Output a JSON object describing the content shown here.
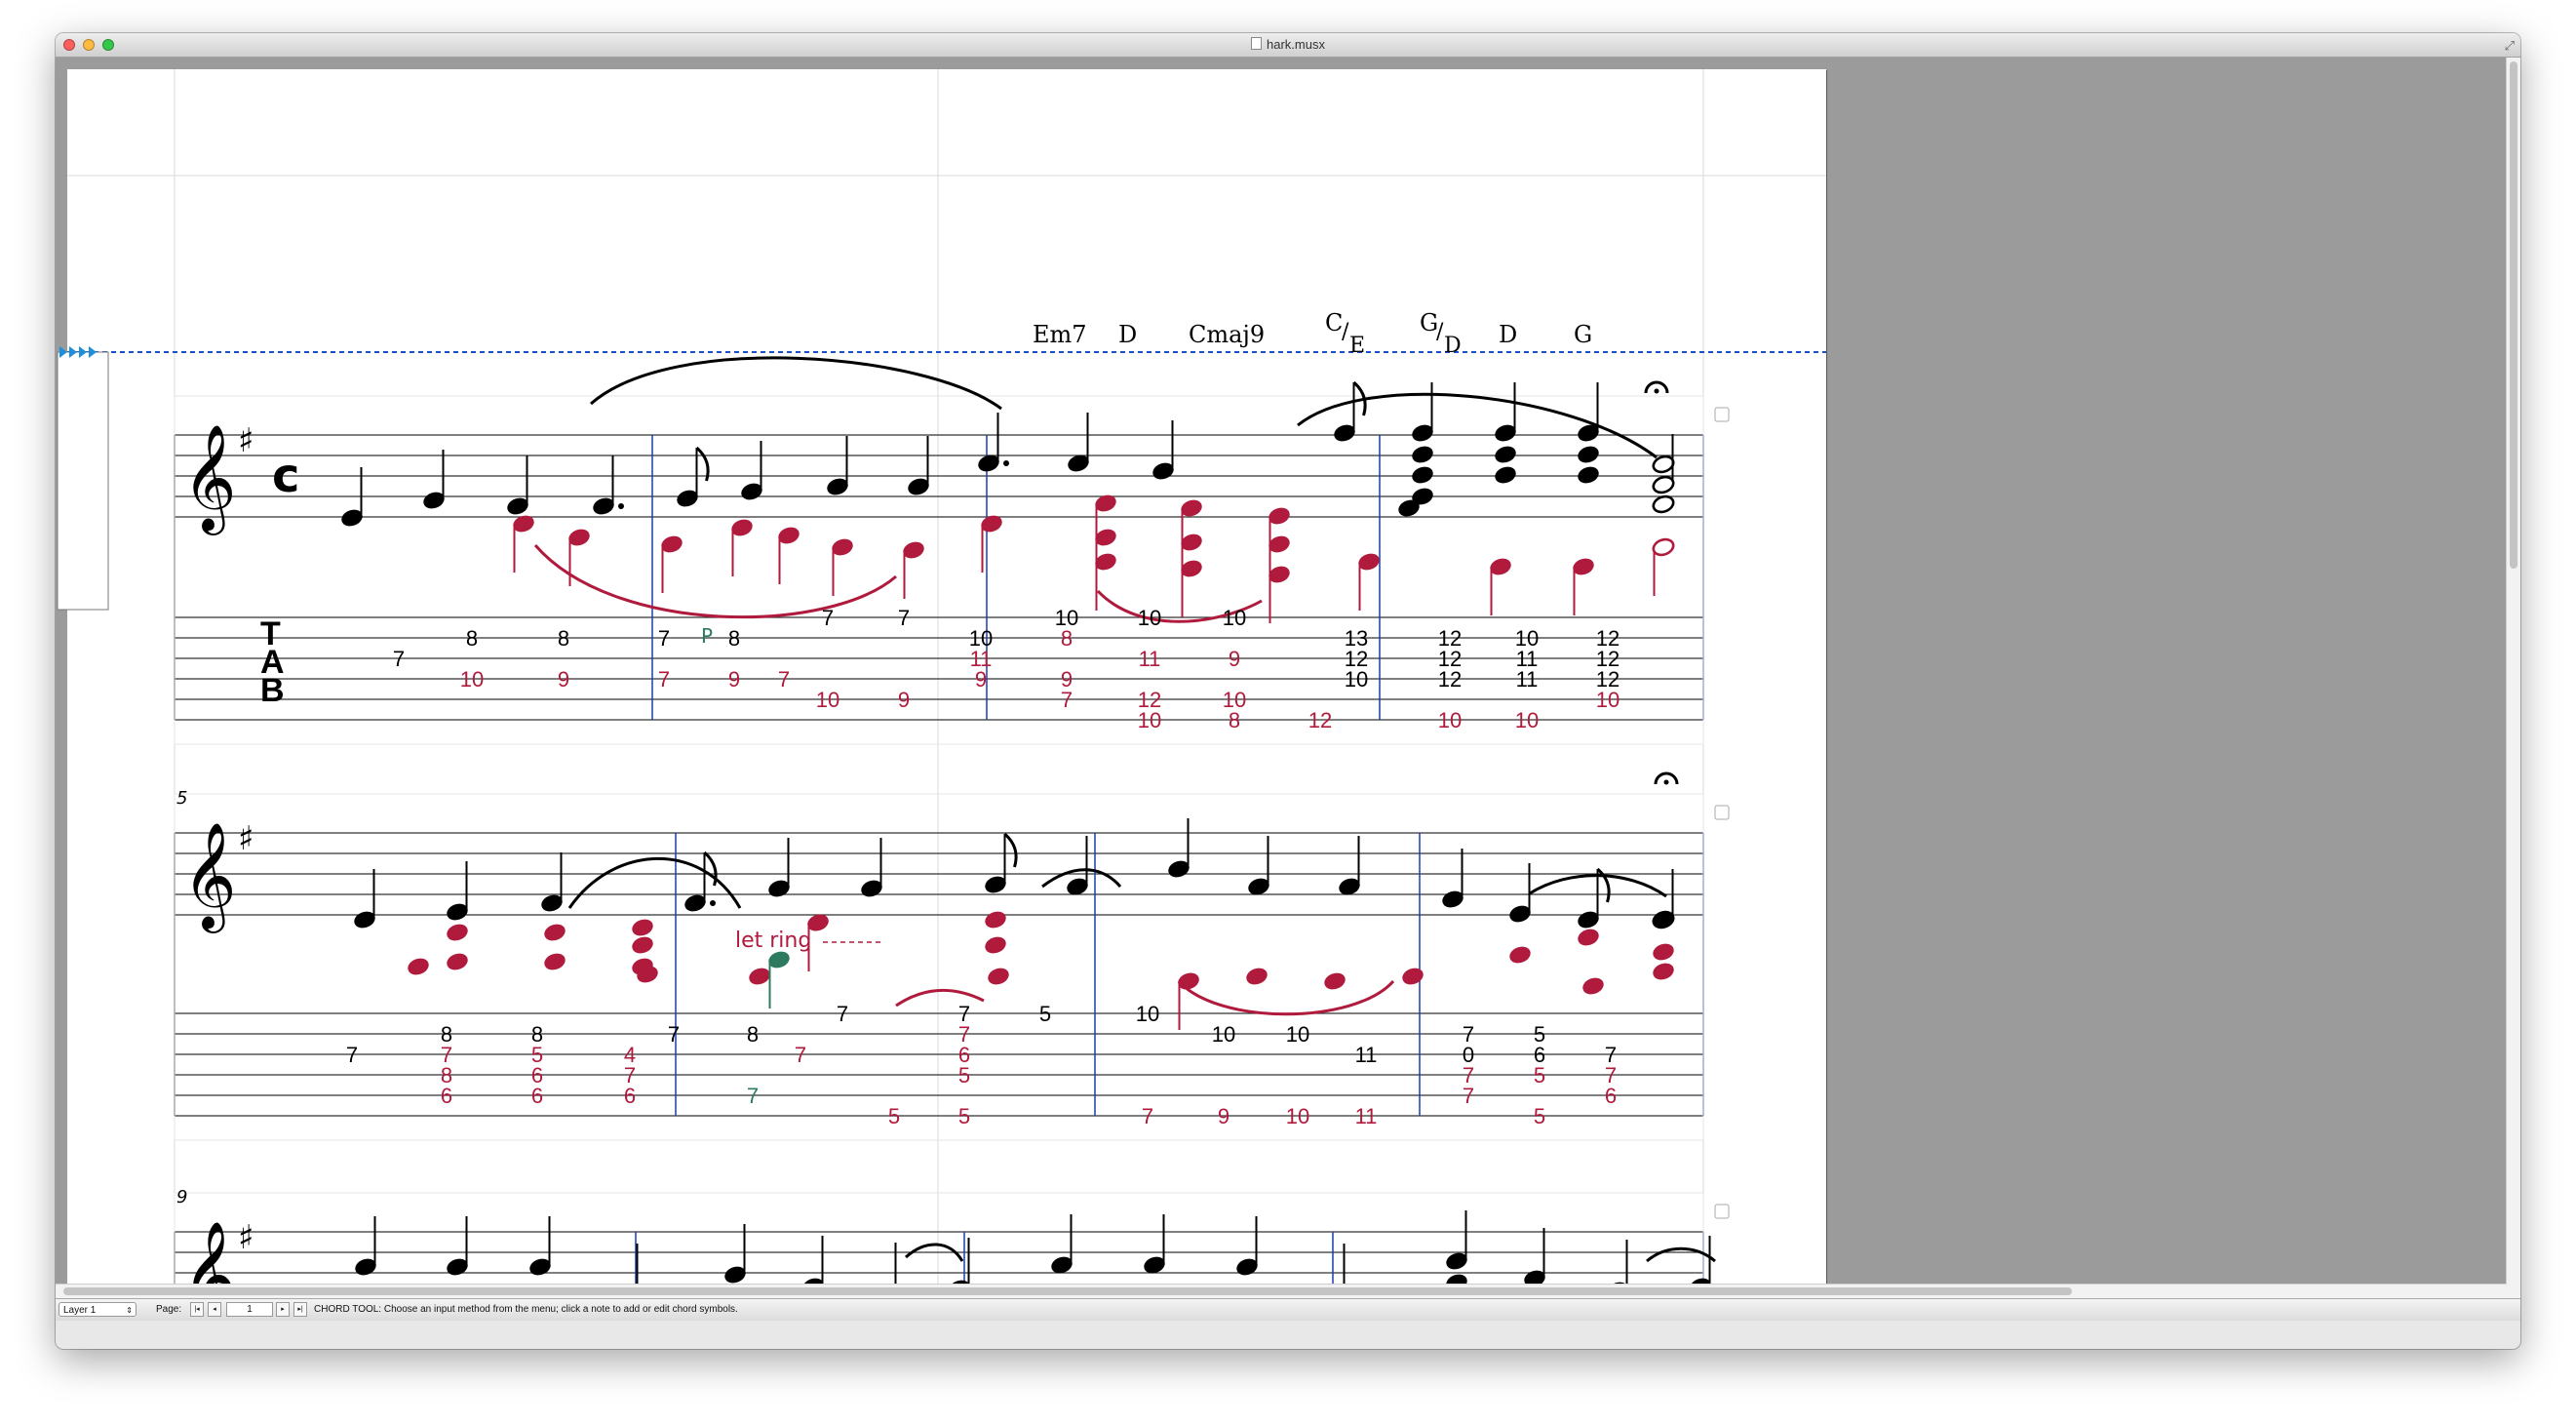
{
  "window": {
    "title": "hark.musx"
  },
  "status_bar": {
    "layer_label": "Layer 1",
    "page_label": "Page:",
    "page_value": "1",
    "message": "CHORD TOOL: Choose an input method from the menu; click a note to add or edit chord symbols."
  },
  "score": {
    "measure_numbers": [
      "5",
      "9"
    ],
    "chord_symbols": [
      {
        "root": "Em7",
        "bass": ""
      },
      {
        "root": "D",
        "bass": ""
      },
      {
        "root": "Cmaj9",
        "bass": ""
      },
      {
        "root": "C",
        "bass": "E"
      },
      {
        "root": "G",
        "bass": "D"
      },
      {
        "root": "D",
        "bass": ""
      },
      {
        "root": "G",
        "bass": ""
      }
    ],
    "tab_clef": [
      "T",
      "A",
      "B"
    ],
    "expressions": {
      "let_ring_1": "let ring",
      "let_ring_2": "let ring",
      "pull_off": "P"
    },
    "colors": {
      "voice1": "#000000",
      "voice2": "#b01a3c",
      "voice3": "#2d7a5f",
      "barline_blue": "#1a3fae",
      "dashed_line": "#1a4fd0",
      "pasteboard": "#9b9b9b"
    },
    "tab_system_1": [
      {
        "t": "7",
        "s": 2,
        "v": 1
      },
      {
        "t": "8",
        "s": 1,
        "v": 1
      },
      {
        "t": "10",
        "s": 3,
        "v": 2
      },
      {
        "t": "8",
        "s": 1,
        "v": 1
      },
      {
        "t": "9",
        "s": 3,
        "v": 2
      },
      {
        "t": "7",
        "s": 1,
        "v": 1
      },
      {
        "t": "7",
        "s": 3,
        "v": 2
      },
      {
        "t": "8",
        "s": 1,
        "v": 1
      },
      {
        "t": "9",
        "s": 3,
        "v": 2
      },
      {
        "t": "7",
        "s": 3,
        "v": 2
      },
      {
        "t": "7",
        "s": 0,
        "v": 1
      },
      {
        "t": "10",
        "s": 4,
        "v": 2
      },
      {
        "t": "7",
        "s": 0,
        "v": 1
      },
      {
        "t": "9",
        "s": 4,
        "v": 2
      },
      {
        "t": "10",
        "s": 1,
        "v": 1
      },
      {
        "t": "11",
        "s": 2,
        "v": 2
      },
      {
        "t": "9",
        "s": 3,
        "v": 2
      },
      {
        "t": "10",
        "s": 0,
        "v": 1
      },
      {
        "t": "8",
        "s": 1,
        "v": 2
      },
      {
        "t": "9",
        "s": 3,
        "v": 2
      },
      {
        "t": "7",
        "s": 4,
        "v": 2
      },
      {
        "t": "10",
        "s": 0,
        "v": 1
      },
      {
        "t": "11",
        "s": 2,
        "v": 2
      },
      {
        "t": "12",
        "s": 4,
        "v": 2
      },
      {
        "t": "10",
        "s": 5,
        "v": 2
      },
      {
        "t": "10",
        "s": 0,
        "v": 1
      },
      {
        "t": "9",
        "s": 2,
        "v": 2
      },
      {
        "t": "10",
        "s": 4,
        "v": 2
      },
      {
        "t": "8",
        "s": 5,
        "v": 2
      },
      {
        "t": "12",
        "s": 5,
        "v": 2
      },
      {
        "t": "13",
        "s": 1,
        "v": 1
      },
      {
        "t": "12",
        "s": 2,
        "v": 1
      },
      {
        "t": "10",
        "s": 3,
        "v": 1
      },
      {
        "t": "12",
        "s": 1,
        "v": 1
      },
      {
        "t": "12",
        "s": 2,
        "v": 1
      },
      {
        "t": "12",
        "s": 3,
        "v": 1
      },
      {
        "t": "10",
        "s": 5,
        "v": 2
      },
      {
        "t": "10",
        "s": 1,
        "v": 1
      },
      {
        "t": "11",
        "s": 2,
        "v": 1
      },
      {
        "t": "11",
        "s": 3,
        "v": 1
      },
      {
        "t": "10",
        "s": 5,
        "v": 2
      },
      {
        "t": "12",
        "s": 1,
        "v": 1
      },
      {
        "t": "12",
        "s": 2,
        "v": 1
      },
      {
        "t": "12",
        "s": 3,
        "v": 1
      },
      {
        "t": "10",
        "s": 4,
        "v": 2
      }
    ],
    "tab_system_2": [
      {
        "t": "7",
        "s": 2,
        "v": 1
      },
      {
        "t": "8",
        "s": 1,
        "v": 1
      },
      {
        "t": "7",
        "s": 2,
        "v": 2
      },
      {
        "t": "8",
        "s": 3,
        "v": 2
      },
      {
        "t": "6",
        "s": 4,
        "v": 2
      },
      {
        "t": "8",
        "s": 1,
        "v": 1
      },
      {
        "t": "5",
        "s": 2,
        "v": 2
      },
      {
        "t": "6",
        "s": 3,
        "v": 2
      },
      {
        "t": "6",
        "s": 4,
        "v": 2
      },
      {
        "t": "4",
        "s": 2,
        "v": 2
      },
      {
        "t": "7",
        "s": 3,
        "v": 2
      },
      {
        "t": "6",
        "s": 4,
        "v": 2
      },
      {
        "t": "7",
        "s": 1,
        "v": 1
      },
      {
        "t": "8",
        "s": 1,
        "v": 1
      },
      {
        "t": "7",
        "s": 4,
        "v": 3
      },
      {
        "t": "7",
        "s": 2,
        "v": 2
      },
      {
        "t": "7",
        "s": 0,
        "v": 1
      },
      {
        "t": "5",
        "s": 5,
        "v": 2
      },
      {
        "t": "7",
        "s": 0,
        "v": 1
      },
      {
        "t": "7",
        "s": 1,
        "v": 2
      },
      {
        "t": "6",
        "s": 2,
        "v": 2
      },
      {
        "t": "5",
        "s": 3,
        "v": 2
      },
      {
        "t": "5",
        "s": 5,
        "v": 2
      },
      {
        "t": "5",
        "s": 0,
        "v": 1
      },
      {
        "t": "10",
        "s": 0,
        "v": 1
      },
      {
        "t": "7",
        "s": 5,
        "v": 2
      },
      {
        "t": "10",
        "s": 1,
        "v": 1
      },
      {
        "t": "9",
        "s": 5,
        "v": 2
      },
      {
        "t": "10",
        "s": 1,
        "v": 1
      },
      {
        "t": "10",
        "s": 5,
        "v": 2
      },
      {
        "t": "11",
        "s": 2,
        "v": 1
      },
      {
        "t": "11",
        "s": 5,
        "v": 2
      },
      {
        "t": "7",
        "s": 1,
        "v": 1
      },
      {
        "t": "0",
        "s": 2,
        "v": 1
      },
      {
        "t": "7",
        "s": 3,
        "v": 2
      },
      {
        "t": "7",
        "s": 4,
        "v": 2
      },
      {
        "t": "5",
        "s": 1,
        "v": 1
      },
      {
        "t": "6",
        "s": 2,
        "v": 1
      },
      {
        "t": "5",
        "s": 3,
        "v": 2
      },
      {
        "t": "5",
        "s": 5,
        "v": 2
      },
      {
        "t": "7",
        "s": 2,
        "v": 1
      },
      {
        "t": "7",
        "s": 3,
        "v": 2
      },
      {
        "t": "6",
        "s": 4,
        "v": 2
      }
    ]
  }
}
